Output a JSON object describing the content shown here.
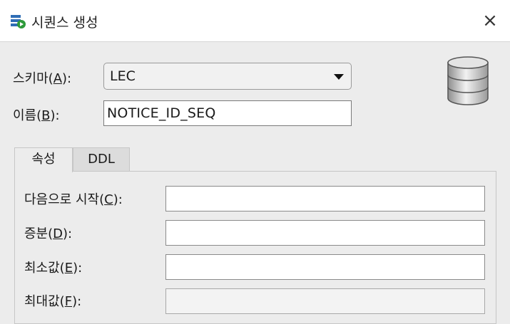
{
  "window": {
    "title": "시퀀스 생성",
    "icon": "sequence-create-icon",
    "close_label": "×"
  },
  "schema": {
    "label_prefix": "스키마(",
    "label_mnemonic": "A",
    "label_suffix": "):",
    "value": "LEC"
  },
  "name": {
    "label_prefix": "이름(",
    "label_mnemonic": "B",
    "label_suffix": "):",
    "value": "NOTICE_ID_SEQ"
  },
  "tabs": [
    {
      "label": "속성",
      "active": true
    },
    {
      "label": "DDL",
      "active": false
    }
  ],
  "properties": {
    "start_with": {
      "label_prefix": "다음으로 시작(",
      "label_mnemonic": "C",
      "label_suffix": "):",
      "value": ""
    },
    "increment": {
      "label_prefix": "증분(",
      "label_mnemonic": "D",
      "label_suffix": "):",
      "value": ""
    },
    "min_value": {
      "label_prefix": "최소값(",
      "label_mnemonic": "E",
      "label_suffix": "):",
      "value": ""
    },
    "max_value": {
      "label_prefix": "최대값(",
      "label_mnemonic": "F",
      "label_suffix": "):",
      "value": ""
    }
  },
  "colors": {
    "dialog_bg": "#ececec",
    "titlebar_bg": "#ffffff",
    "icon_blue": "#2f6db5",
    "icon_green": "#2e9a3a"
  }
}
